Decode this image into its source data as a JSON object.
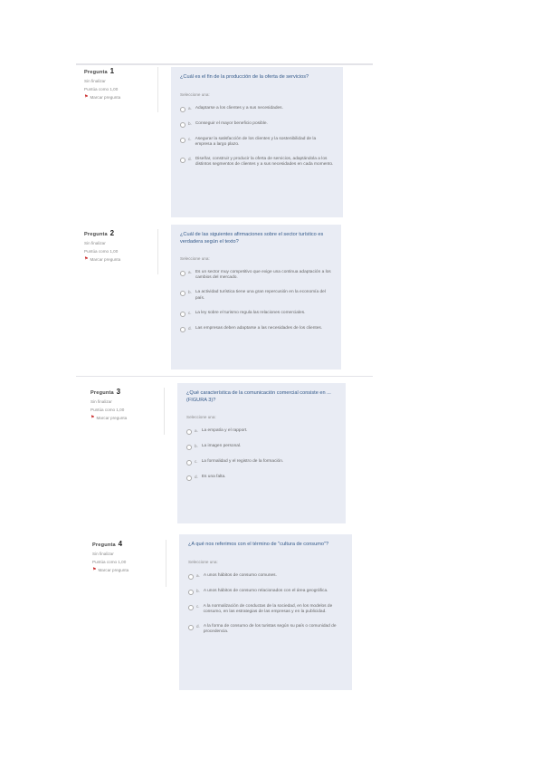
{
  "questions": [
    {
      "label": "Pregunta",
      "number": "1",
      "status": "Sin finalizar",
      "score": "Puntúa como 1,00",
      "flag": "Marcar pregunta",
      "text": "¿Cuál es el fin de la producción de la oferta de servicios?",
      "prompt": "Seleccione una:",
      "options": [
        {
          "letter": "a.",
          "text": "Adaptarse a los clientes y a sus necesidades."
        },
        {
          "letter": "b.",
          "text": "Conseguir el mayor beneficio posible."
        },
        {
          "letter": "c.",
          "text": "Asegurar la satisfacción de los clientes y la sostenibilidad de la empresa a largo plazo."
        },
        {
          "letter": "d.",
          "text": "Diseñar, construir y producir la oferta de servicios, adaptándola a los distintos segmentos de clientes y a sus necesidades en cada momento."
        }
      ]
    },
    {
      "label": "Pregunta",
      "number": "2",
      "status": "Sin finalizar",
      "score": "Puntúa como 1,00",
      "flag": "Marcar pregunta",
      "text": "¿Cuál de las siguientes afirmaciones sobre el sector turístico es verdadera según el texto?",
      "prompt": "Seleccione una:",
      "options": [
        {
          "letter": "a.",
          "text": "Es un sector muy competitivo que exige una continua adaptación a los cambios del mercado."
        },
        {
          "letter": "b.",
          "text": "La actividad turística tiene una gran repercusión en la economía del país."
        },
        {
          "letter": "c.",
          "text": "La ley sobre el turismo regula las relaciones comerciales."
        },
        {
          "letter": "d.",
          "text": "Las empresas deben adaptarse a las necesidades de los clientes."
        }
      ]
    },
    {
      "label": "Pregunta",
      "number": "3",
      "status": "Sin finalizar",
      "score": "Puntúa como 1,00",
      "flag": "Marcar pregunta",
      "text": "¿Qué característica de la comunicación comercial consiste en ... (FIGURA 3)?",
      "prompt": "Seleccione una:",
      "options": [
        {
          "letter": "a.",
          "text": "La empatía y el rapport."
        },
        {
          "letter": "b.",
          "text": "La imagen personal."
        },
        {
          "letter": "c.",
          "text": "La formalidad y el registro de la formación."
        },
        {
          "letter": "d.",
          "text": "Es una falta."
        }
      ]
    },
    {
      "label": "Pregunta",
      "number": "4",
      "status": "Sin finalizar",
      "score": "Puntúa como 1,00",
      "flag": "Marcar pregunta",
      "text": "¿A qué nos referimos con el término de \"cultura de consumo\"?",
      "prompt": "Seleccione una:",
      "options": [
        {
          "letter": "a.",
          "text": "A unos hábitos de consumo comunes."
        },
        {
          "letter": "b.",
          "text": "A unos hábitos de consumo relacionados con el área geográfica."
        },
        {
          "letter": "c.",
          "text": "A la normalización de conductas de la sociedad, en los modelos de consumo, en las estrategias de las empresas y en la publicidad."
        },
        {
          "letter": "d.",
          "text": "A la forma de consumo de los turistas según su país o comunidad de procedencia."
        }
      ]
    }
  ]
}
